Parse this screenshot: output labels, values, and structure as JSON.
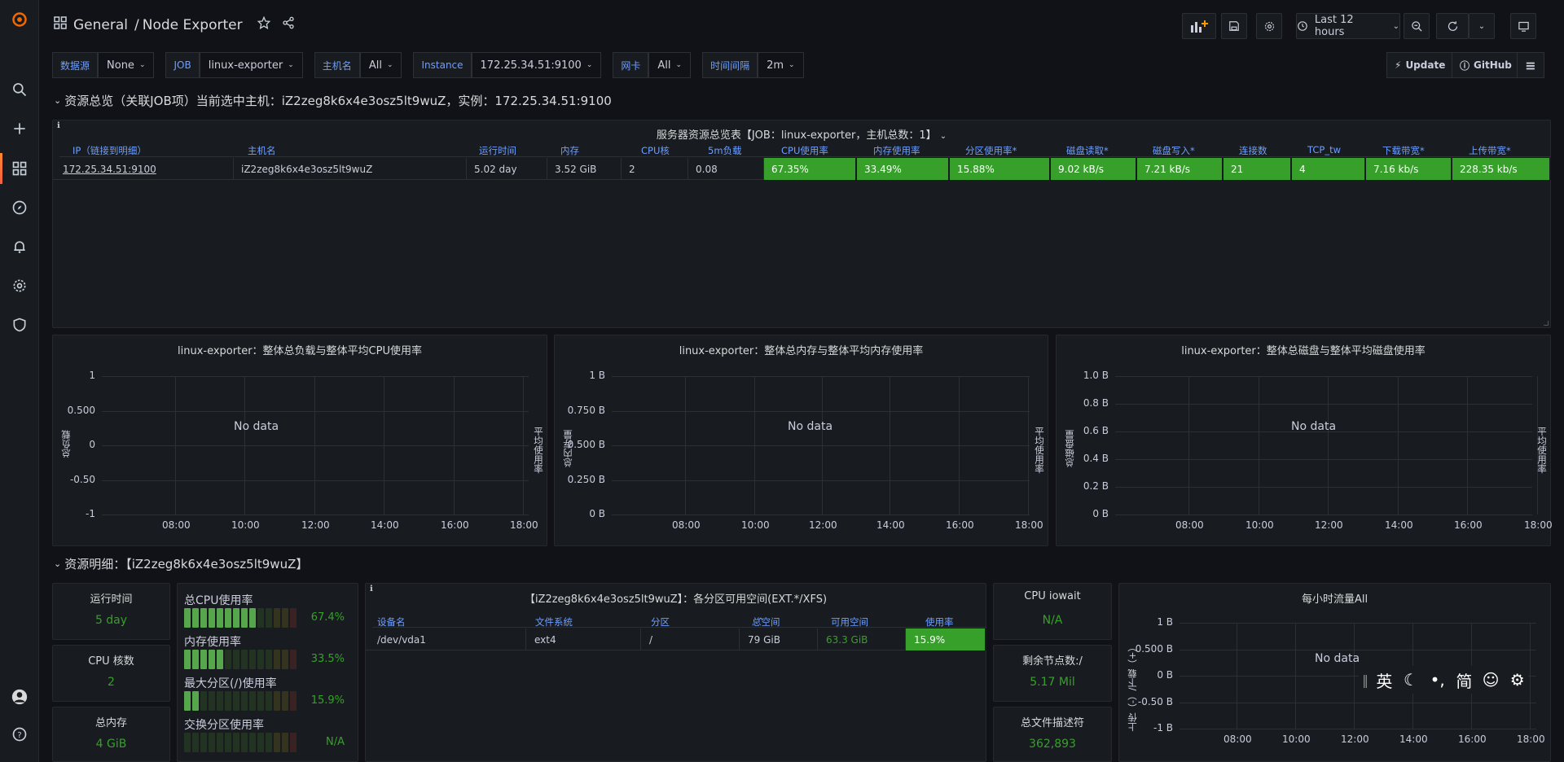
{
  "nav": {
    "breadcrumb_folder": "General",
    "breadcrumb_sep": "/",
    "dashboard_title": "Node Exporter",
    "time_range": "Last 12 hours"
  },
  "variables": [
    {
      "label": "数据源",
      "value": "None"
    },
    {
      "label": "JOB",
      "value": "linux-exporter"
    },
    {
      "label": "主机名",
      "value": "All"
    },
    {
      "label": "Instance",
      "value": "172.25.34.51:9100"
    },
    {
      "label": "网卡",
      "value": "All"
    },
    {
      "label": "时间间隔",
      "value": "2m"
    }
  ],
  "links": {
    "update": "Update",
    "github": "GitHub"
  },
  "row1": {
    "title": "资源总览（关联JOB项）当前选中主机：iZ2zeg8k6x4e3osz5lt9wuZ，实例：172.25.34.51:9100"
  },
  "overview_table": {
    "title": "服务器资源总览表【JOB：linux-exporter，主机总数：1】",
    "headers": [
      "IP（链接到明细）",
      "主机名",
      "运行时间",
      "内存",
      "CPU核",
      "5m负载",
      "CPU使用率",
      "内存使用率",
      "分区使用率*",
      "磁盘读取*",
      "磁盘写入*",
      "连接数",
      "TCP_tw",
      "下载带宽*",
      "上传带宽*"
    ],
    "row": [
      "172.25.34.51:9100",
      "iZ2zeg8k6x4e3osz5lt9wuZ",
      "5.02 day",
      "3.52 GiB",
      "2",
      "0.08",
      "67.35%",
      "33.49%",
      "15.88%",
      "9.02 kB/s",
      "7.21 kB/s",
      "21",
      "4",
      "7.16 kb/s",
      "228.35 kb/s"
    ]
  },
  "graphs": [
    {
      "title": "linux-exporter：整体总负载与整体平均CPU使用率",
      "y_ticks": [
        "1",
        "0.500",
        "0",
        "-0.50",
        "-1"
      ],
      "x_ticks": [
        "08:00",
        "10:00",
        "12:00",
        "14:00",
        "16:00",
        "18:00"
      ],
      "left_label": "总负载",
      "right_label": "平均使用率",
      "no_data": "No data"
    },
    {
      "title": "linux-exporter：整体总内存与整体平均内存使用率",
      "y_ticks": [
        "1 B",
        "0.750 B",
        "0.500 B",
        "0.250 B",
        "0 B"
      ],
      "x_ticks": [
        "08:00",
        "10:00",
        "12:00",
        "14:00",
        "16:00",
        "18:00"
      ],
      "left_label": "总内存量",
      "right_label": "平均使用率",
      "no_data": "No data"
    },
    {
      "title": "linux-exporter：整体总磁盘与整体平均磁盘使用率",
      "y_ticks": [
        "1.0 B",
        "0.8 B",
        "0.6 B",
        "0.4 B",
        "0.2 B",
        "0 B"
      ],
      "x_ticks": [
        "08:00",
        "10:00",
        "12:00",
        "14:00",
        "16:00",
        "18:00"
      ],
      "left_label": "总磁盘量",
      "right_label": "平均使用率",
      "no_data": "No data"
    }
  ],
  "row2": {
    "title": "资源明细：【iZ2zeg8k6x4e3osz5lt9wuZ】"
  },
  "stats_left": [
    {
      "title": "运行时间",
      "value": "5 day"
    },
    {
      "title": "CPU 核数",
      "value": "2"
    },
    {
      "title": "总内存",
      "value": "4 GiB"
    }
  ],
  "bar_gauges": [
    {
      "label": "总CPU使用率",
      "value": "67.4%",
      "fraction": 0.674
    },
    {
      "label": "内存使用率",
      "value": "33.5%",
      "fraction": 0.335
    },
    {
      "label": "最大分区(/)使用率",
      "value": "15.9%",
      "fraction": 0.159
    },
    {
      "label": "交换分区使用率",
      "value": "N/A",
      "fraction": 0
    }
  ],
  "partition_table": {
    "title": "【iZ2zeg8k6x4e3osz5lt9wuZ】：各分区可用空间(EXT.*/XFS)",
    "headers": [
      "设备名",
      "文件系统",
      "分区",
      "总空间",
      "可用空间",
      "使用率"
    ],
    "row": [
      "/dev/vda1",
      "ext4",
      "/",
      "79 GiB",
      "63.3 GiB",
      "15.9%"
    ]
  },
  "stats_right": [
    {
      "title": "CPU iowait",
      "value": "N/A"
    },
    {
      "title": "剩余节点数:/",
      "value": "5.17 Mil"
    },
    {
      "title": "总文件描述符",
      "value": "362,893"
    }
  ],
  "traffic_graph": {
    "title": "每小时流量All",
    "y_ticks": [
      "1 B",
      "0.500 B",
      "0 B",
      "-0.50 B",
      "-1 B"
    ],
    "x_ticks": [
      "08:00",
      "10:00",
      "12:00",
      "14:00",
      "16:00",
      "18:00"
    ],
    "left_label": "上传（-）/下载（+）",
    "no_data": "No data"
  },
  "ime": [
    "英",
    "☾",
    "•,",
    "简",
    "☺",
    "⚙"
  ]
}
